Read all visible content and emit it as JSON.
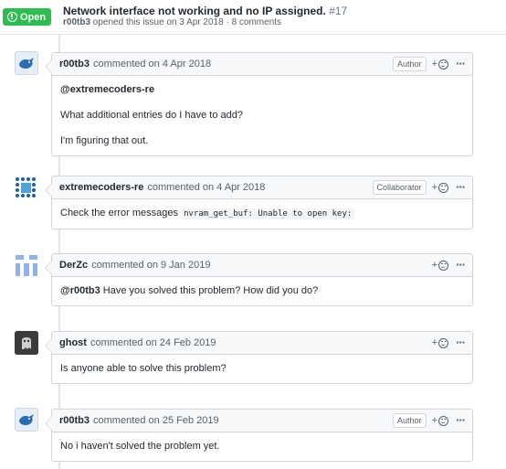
{
  "issue": {
    "state": "Open",
    "title": "Network interface not working and no IP assigned.",
    "number": "#17",
    "meta_author": "r00tb3",
    "meta_rest": " opened this issue on 3 Apr 2018 · 8 comments"
  },
  "comments": [
    {
      "author": "r00tb3",
      "date": "commented on 4 Apr 2018",
      "role": "Author",
      "body": {
        "mention": "@extremecoders-re",
        "p1": "What additional entries do I have to add?",
        "p2": "I'm figuring that out."
      }
    },
    {
      "author": "extremecoders-re",
      "date": "commented on 4 Apr 2018",
      "role": "Collaborator",
      "body": {
        "text": "Check the error messages ",
        "code": "nvram_get_buf: Unable to open key:"
      }
    },
    {
      "author": "DerZc",
      "date": "commented on 9 Jan 2019",
      "role": "",
      "body": {
        "mention": "@r00tb3",
        "text": " Have you solved this problem? How did you do?"
      }
    },
    {
      "author": "ghost",
      "date": "commented on 24 Feb 2019",
      "role": "",
      "body": {
        "text": "Is anyone able to solve this problem?"
      }
    },
    {
      "author": "r00tb3",
      "date": "commented on 25 Feb 2019",
      "role": "Author",
      "body": {
        "text": "No i haven't solved the problem yet."
      }
    }
  ],
  "actions": {
    "reaction_plus": "+",
    "more": "···"
  },
  "icons": {
    "state": "issue-opened-icon",
    "reaction": "smiley-icon",
    "more": "kebab-horizontal-icon"
  },
  "colors": {
    "open_green": "#2cbe4e",
    "border": "#d1d5da",
    "header_bg": "#f6f8fa"
  }
}
